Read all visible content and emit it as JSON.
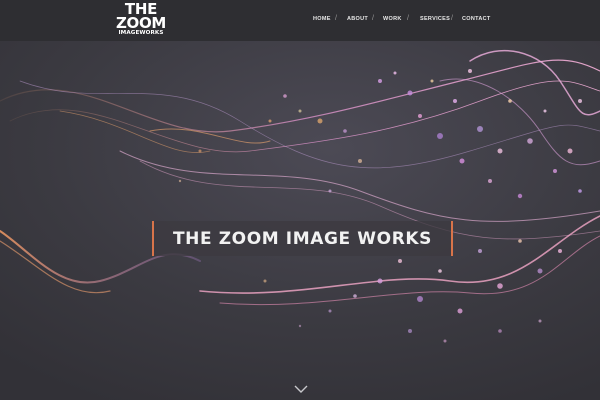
{
  "brand": {
    "line1": "THE",
    "line2": "ZOOM",
    "line3": "IMAGEWORKS"
  },
  "nav": {
    "items": [
      "HOME",
      "ABOUT",
      "WORK",
      "SERVICES",
      "CONTACT"
    ],
    "separator": "/"
  },
  "hero": {
    "title": "THE ZOOM IMAGE WORKS"
  },
  "icons": {
    "scroll_down": "chevron-down-icon"
  },
  "colors": {
    "topbar": "#2e2e32",
    "hero_bg": "#3a3a40",
    "accent": "#d8744a"
  }
}
